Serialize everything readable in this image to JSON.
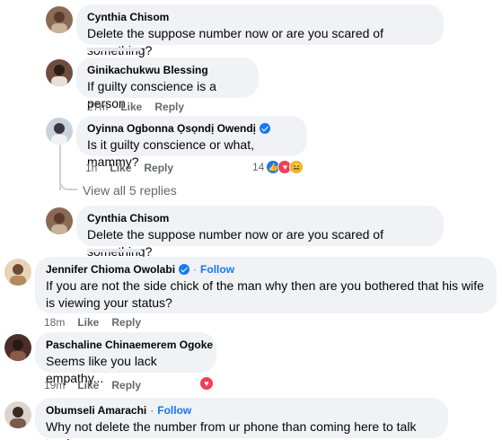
{
  "comments": [
    {
      "name": "Cynthia Chisom",
      "text": "Delete the suppose number now or are you scared of something?"
    },
    {
      "name": "Ginikachukwu Blessing",
      "text": "If guilty conscience is a person",
      "time": "27m",
      "like": "Like",
      "reply": "Reply"
    },
    {
      "name": "Oyinna Ogbonna Ọsọndị Owendị",
      "text": "Is it guilty conscience or what, mammy?",
      "time": "1h",
      "like": "Like",
      "reply": "Reply",
      "reaction_count": "14"
    },
    {
      "name": "Cynthia Chisom",
      "text": "Delete the suppose number now or are you scared of something?"
    },
    {
      "name": "Jennifer Chioma Owolabi",
      "follow": "Follow",
      "text": "If you are not the side chick of the man why then are you bothered that his wife is viewing your status?",
      "time": "18m",
      "like": "Like",
      "reply": "Reply"
    },
    {
      "name": "Paschaline Chinaemerem Ogoke",
      "text": "Seems like you lack empathy...",
      "time": "19m",
      "like": "Like",
      "reply": "Reply"
    },
    {
      "name": "Obumseli Amarachi",
      "follow": "Follow",
      "text": "Why not delete the number from ur phone than coming here to talk trash."
    }
  ],
  "view_all_replies": "View all 5 replies",
  "separator": "·",
  "colors": {
    "bubble": "#f0f2f5",
    "link": "#1877f2",
    "meta": "#65676b",
    "love": "#f33e58"
  }
}
